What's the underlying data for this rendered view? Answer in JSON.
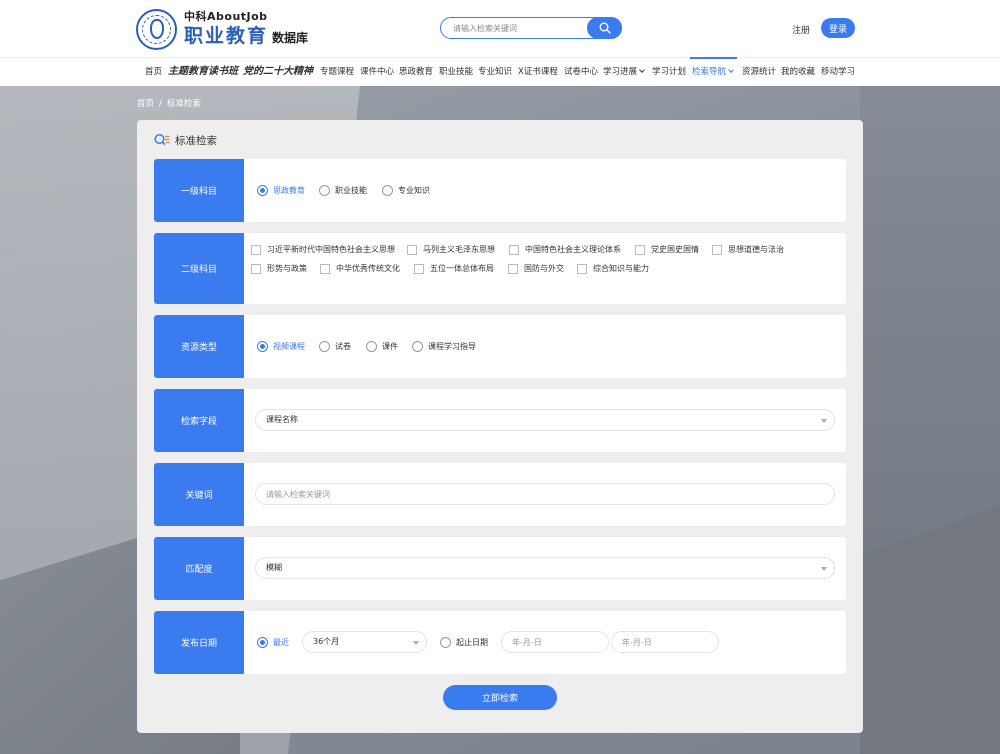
{
  "logo": {
    "top": "中科AboutJob",
    "main": "职业教育",
    "sub": "数据库"
  },
  "search": {
    "placeholder": "请输入检索关键词"
  },
  "auth": {
    "register": "注册",
    "login": "登录"
  },
  "nav": [
    {
      "label": "首页",
      "dropdown": false
    },
    {
      "label": "主题教育读书班",
      "dropdown": false
    },
    {
      "label": "党的二十大精神",
      "dropdown": false
    },
    {
      "label": "专题课程",
      "dropdown": false
    },
    {
      "label": "课件中心",
      "dropdown": false
    },
    {
      "label": "思政教育",
      "dropdown": false
    },
    {
      "label": "职业技能",
      "dropdown": false
    },
    {
      "label": "专业知识",
      "dropdown": false
    },
    {
      "label": "X证书课程",
      "dropdown": false
    },
    {
      "label": "试卷中心",
      "dropdown": false
    },
    {
      "label": "学习进展",
      "dropdown": true
    },
    {
      "label": "学习计划",
      "dropdown": false
    },
    {
      "label": "检索导航",
      "dropdown": true,
      "active": true
    },
    {
      "label": "资源统计",
      "dropdown": false
    },
    {
      "label": "我的收藏",
      "dropdown": false
    },
    {
      "label": "移动学习",
      "dropdown": false
    }
  ],
  "breadcrumb": {
    "home": "首页",
    "sep": "/",
    "current": "标准检索"
  },
  "panel": {
    "title": "标准检索"
  },
  "form": {
    "level1": {
      "label": "一级科目",
      "options": [
        "思政教育",
        "职业技能",
        "专业知识"
      ],
      "selected": 0
    },
    "level2": {
      "label": "二级科目",
      "options": [
        "习近平新时代中国特色社会主义思想",
        "马列主义毛泽东思想",
        "中国特色社会主义理论体系",
        "党史国史国情",
        "思想道德与法治",
        "形势与政策",
        "中华优秀传统文化",
        "五位一体总体布局",
        "国防与外交",
        "综合知识与能力"
      ]
    },
    "resource_type": {
      "label": "资源类型",
      "options": [
        "视频课程",
        "试卷",
        "课件",
        "课程学习指导"
      ],
      "selected": 0
    },
    "search_field": {
      "label": "检索字段",
      "value": "课程名称"
    },
    "keyword": {
      "label": "关键词",
      "placeholder": "请输入检索关键词"
    },
    "match": {
      "label": "匹配度",
      "value": "模糊"
    },
    "publish_date": {
      "label": "发布日期",
      "recent_label": "最近",
      "recent_value": "36个月",
      "range_label": "起止日期",
      "start_placeholder": "年-月-日",
      "end_placeholder": "年-月-日"
    },
    "submit": "立即检索"
  },
  "colors": {
    "accent": "#3a7bf0",
    "panel_bg": "#eeeeef"
  }
}
